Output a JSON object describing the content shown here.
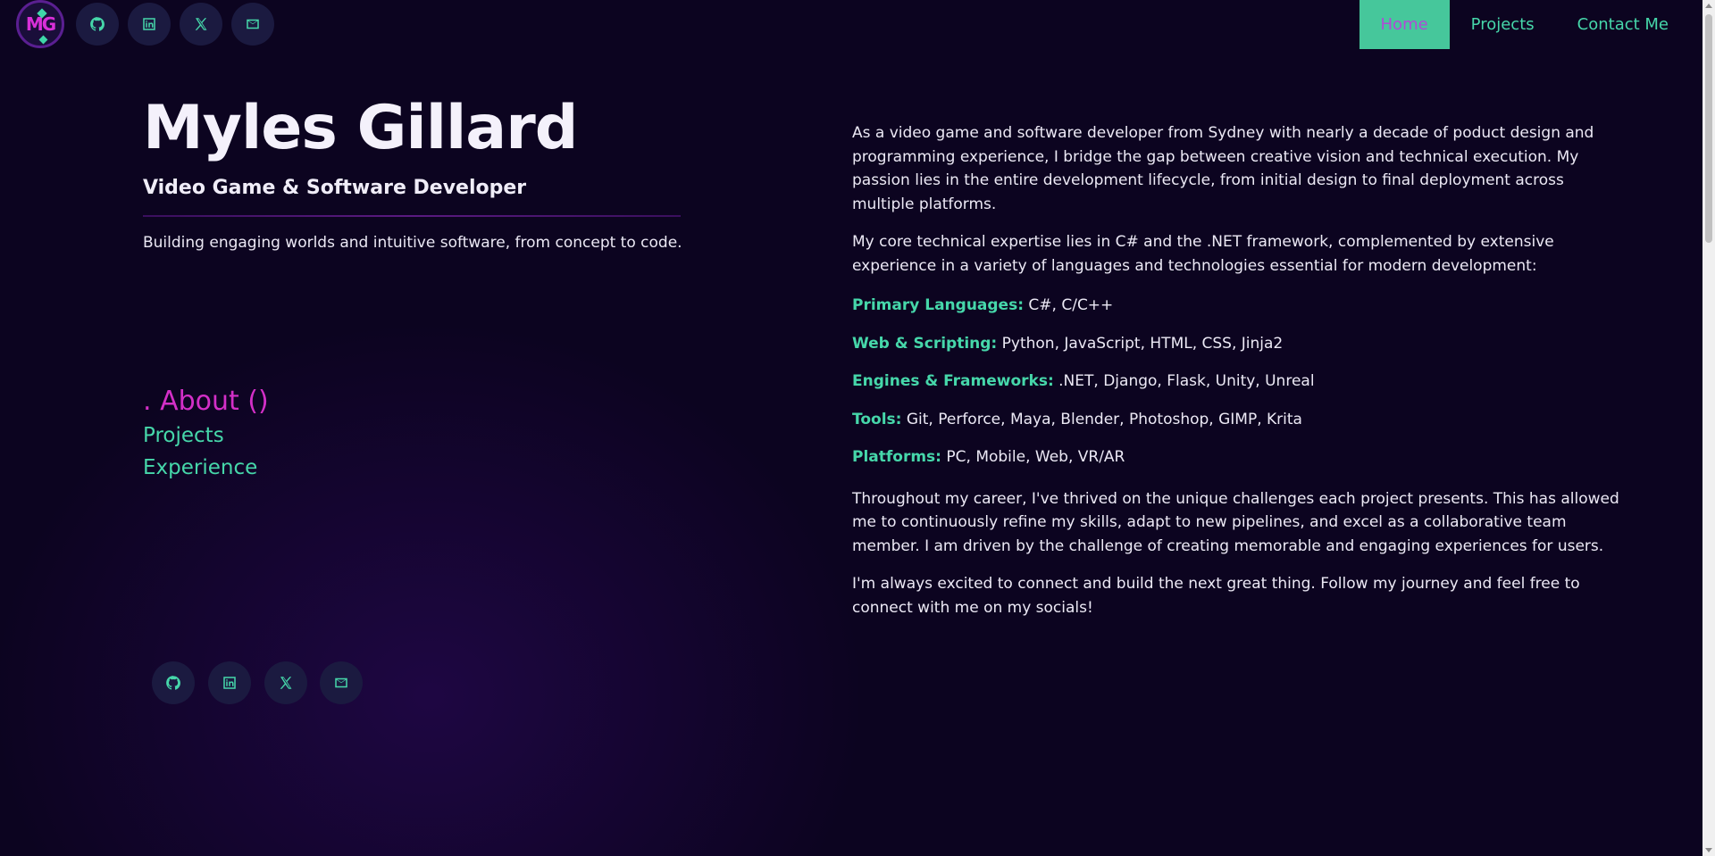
{
  "header": {
    "logo_text": "MG",
    "social": [
      {
        "name": "github",
        "icon": "github-icon"
      },
      {
        "name": "linkedin",
        "icon": "linkedin-icon"
      },
      {
        "name": "x",
        "icon": "x-icon"
      },
      {
        "name": "email",
        "icon": "envelope-icon"
      }
    ],
    "nav": [
      {
        "label": "Home",
        "active": true
      },
      {
        "label": "Projects",
        "active": false
      },
      {
        "label": "Contact Me",
        "active": false
      }
    ]
  },
  "hero": {
    "name": "Myles Gillard",
    "role": "Video Game & Software Developer",
    "tagline": "Building engaging worlds and intuitive software, from concept to code."
  },
  "sections": {
    "active": ". About ()",
    "items": [
      "Projects",
      "Experience"
    ]
  },
  "about": {
    "intro": "As a video game and software developer from Sydney with nearly a decade of poduct design and programming experience, I bridge the gap between creative vision and technical execution. My passion lies in the entire development lifecycle, from initial design to final deployment across multiple platforms.",
    "expertise": "My core technical expertise lies in C# and the .NET framework, complemented by extensive experience in a variety of languages and technologies essential for modern development:",
    "skills": [
      {
        "label": "Primary Languages:",
        "value": "C#, C/C++"
      },
      {
        "label": "Web & Scripting:",
        "value": "Python, JavaScript, HTML, CSS, Jinja2"
      },
      {
        "label": "Engines & Frameworks:",
        "value": ".NET, Django, Flask, Unity, Unreal"
      },
      {
        "label": "Tools:",
        "value": "Git, Perforce, Maya, Blender, Photoshop, GIMP, Krita"
      },
      {
        "label": "Platforms:",
        "value": "PC, Mobile, Web, VR/AR"
      }
    ],
    "career": "Throughout my career, I've thrived on the unique challenges each project presents. This has allowed me to continuously refine my skills, adapt to new pipelines, and excel as a collaborative team member. I am driven by the challenge of creating memorable and engaging experiences for users.",
    "closing": "I'm always excited to connect and build the next great thing. Follow my journey and feel free to connect with me on my socials!"
  },
  "colors": {
    "background": "#0c0420",
    "accent_green": "#46d7aa",
    "accent_magenta": "#d32fc7",
    "nav_active_bg": "#46c79b"
  }
}
